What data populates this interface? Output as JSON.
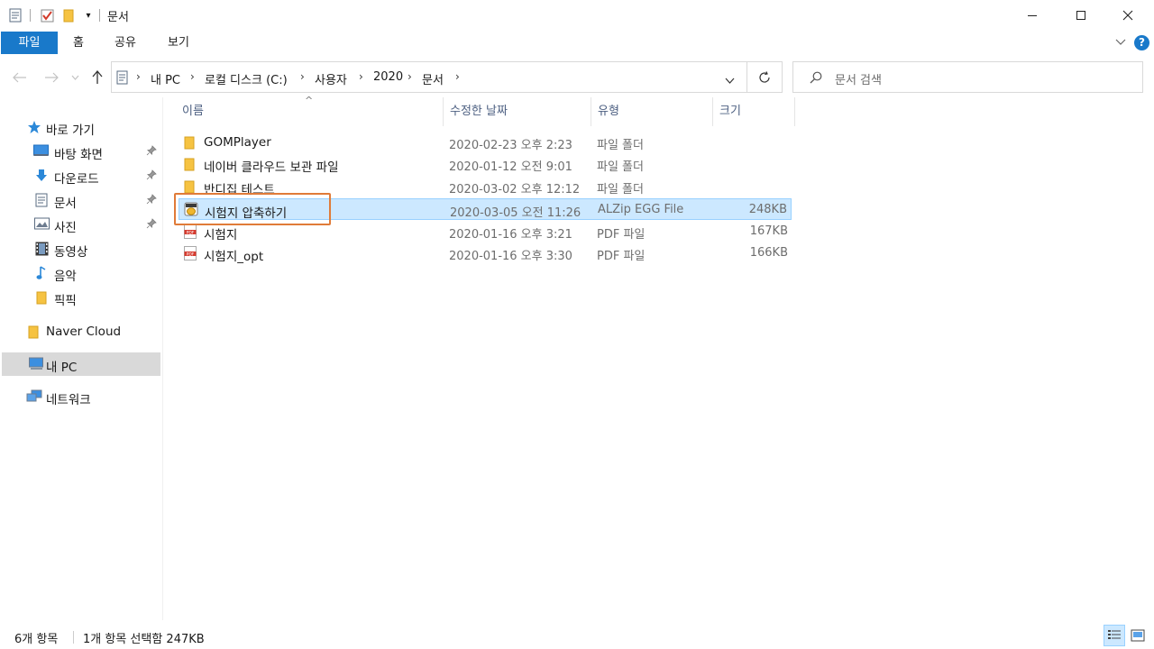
{
  "window": {
    "title": "문서",
    "controls": {
      "minimize": "—",
      "maximize": "☐",
      "close": "✕"
    }
  },
  "ribbon": {
    "tabs": [
      {
        "label": "파일",
        "active": true
      },
      {
        "label": "홈"
      },
      {
        "label": "공유"
      },
      {
        "label": "보기"
      }
    ],
    "help_label": "?"
  },
  "address": {
    "crumbs": [
      "내 PC",
      "로컬 디스크 (C:)",
      "사용자",
      "2020",
      "문서"
    ],
    "search_placeholder": "문서 검색"
  },
  "nav": {
    "quick_access": "바로 가기",
    "pinned": [
      {
        "label": "바탕 화면",
        "icon": "desktop-icon",
        "pinned": true
      },
      {
        "label": "다운로드",
        "icon": "download-icon",
        "pinned": true
      },
      {
        "label": "문서",
        "icon": "document-icon",
        "pinned": true
      },
      {
        "label": "사진",
        "icon": "pictures-icon",
        "pinned": true
      },
      {
        "label": "동영상",
        "icon": "video-icon",
        "pinned": false
      },
      {
        "label": "음악",
        "icon": "music-icon",
        "pinned": false
      },
      {
        "label": "픽픽",
        "icon": "folder-icon",
        "pinned": false
      }
    ],
    "naver_cloud": "Naver Cloud",
    "this_pc": "내 PC",
    "network": "네트워크"
  },
  "columns": {
    "name": "이름",
    "date": "수정한 날짜",
    "type": "유형",
    "size": "크기",
    "sort_indicator": "^"
  },
  "files": [
    {
      "name": "GOMPlayer",
      "date": "2020-02-23 오후 2:23",
      "type": "파일 폴더",
      "size": "",
      "icon": "folder-icon"
    },
    {
      "name": "네이버 클라우드 보관 파일",
      "date": "2020-01-12 오전 9:01",
      "type": "파일 폴더",
      "size": "",
      "icon": "folder-icon"
    },
    {
      "name": "반디집 테스트",
      "date": "2020-03-02 오후 12:12",
      "type": "파일 폴더",
      "size": "",
      "icon": "folder-icon"
    },
    {
      "name": "시험지 압축하기",
      "date": "2020-03-05 오전 11:26",
      "type": "ALZip EGG File",
      "size": "248KB",
      "icon": "egg-archive-icon",
      "selected": true
    },
    {
      "name": "시험지",
      "date": "2020-01-16 오후 3:21",
      "type": "PDF 파일",
      "size": "167KB",
      "icon": "pdf-icon"
    },
    {
      "name": "시험지_opt",
      "date": "2020-01-16 오후 3:30",
      "type": "PDF 파일",
      "size": "166KB",
      "icon": "pdf-icon"
    }
  ],
  "status": {
    "count": "6개 항목",
    "selection": "1개 항목 선택함 247KB"
  },
  "colors": {
    "accent": "#1979ca",
    "selection_bg": "#cce8ff",
    "highlight_box": "#e07b39",
    "folder": "#f6c342"
  }
}
